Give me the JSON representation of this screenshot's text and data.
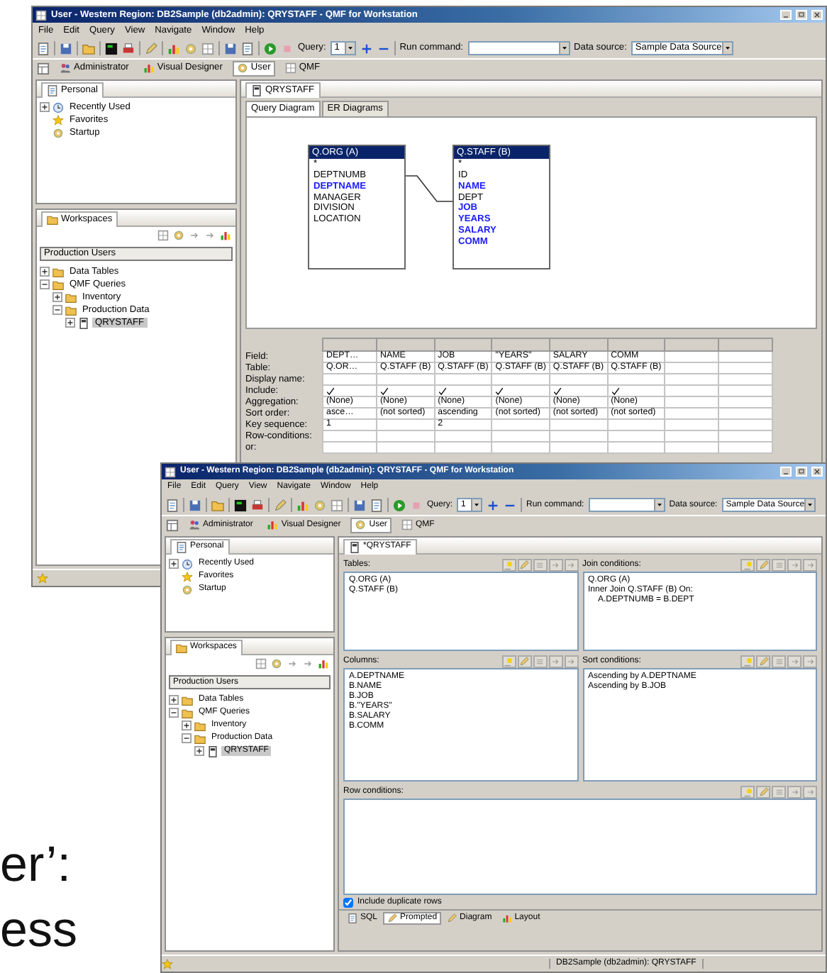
{
  "slide_text": [
    "er’:",
    "ess"
  ],
  "back_window": {
    "title": "User - Western Region: DB2Sample (db2admin): QRYSTAFF - QMF for Workstation",
    "menu": [
      "File",
      "Edit",
      "Query",
      "View",
      "Navigate",
      "Window",
      "Help"
    ],
    "toolbar": {
      "query_label": "Query:",
      "query_value": "1",
      "run_label": "Run command:",
      "source_label": "Data source:",
      "source_value": "Sample Data Source"
    },
    "perspectives": [
      {
        "label": "Administrator",
        "selected": false
      },
      {
        "label": "Visual Designer",
        "selected": false
      },
      {
        "label": "User",
        "selected": true
      },
      {
        "label": "QMF",
        "selected": false
      }
    ],
    "personal": {
      "tab": "Personal",
      "items": [
        {
          "label": "Recently Used",
          "kind": "recent",
          "expanded": false
        },
        {
          "label": "Favorites",
          "kind": "favorites"
        },
        {
          "label": "Startup",
          "kind": "startup"
        }
      ]
    },
    "workspaces": {
      "tab": "Workspaces",
      "filter": "Production Users",
      "tree": [
        {
          "label": "Data Tables",
          "kind": "folder",
          "expanded": false,
          "selected": false
        },
        {
          "label": "QMF Queries",
          "kind": "folder",
          "expanded": true,
          "selected": false,
          "children": [
            {
              "label": "Inventory",
              "kind": "folder",
              "expanded": false,
              "selected": false
            },
            {
              "label": "Production Data",
              "kind": "folder",
              "expanded": true,
              "selected": false,
              "children": [
                {
                  "label": "QRYSTAFF",
                  "kind": "query",
                  "expanded": false,
                  "selected": true
                }
              ]
            }
          ]
        }
      ]
    },
    "editor": {
      "tab": "QRYSTAFF",
      "subtabs": [
        {
          "label": "Query Diagram",
          "selected": true
        },
        {
          "label": "ER Diagrams",
          "selected": false
        }
      ],
      "tables": [
        {
          "title": "Q.ORG (A)",
          "fields": [
            {
              "name": "*",
              "selected": false
            },
            {
              "name": "DEPTNUMB",
              "selected": false
            },
            {
              "name": "DEPTNAME",
              "selected": true
            },
            {
              "name": "MANAGER",
              "selected": false
            },
            {
              "name": "DIVISION",
              "selected": false
            },
            {
              "name": "LOCATION",
              "selected": false
            }
          ]
        },
        {
          "title": "Q.STAFF (B)",
          "fields": [
            {
              "name": "*",
              "selected": false
            },
            {
              "name": "ID",
              "selected": false
            },
            {
              "name": "NAME",
              "selected": true
            },
            {
              "name": "DEPT",
              "selected": false
            },
            {
              "name": "JOB",
              "selected": true
            },
            {
              "name": "YEARS",
              "selected": true
            },
            {
              "name": "SALARY",
              "selected": true
            },
            {
              "name": "COMM",
              "selected": true
            }
          ]
        }
      ],
      "grid": {
        "row_labels": [
          "Field:",
          "Table:",
          "Display name:",
          "Include:",
          "Aggregation:",
          "Sort order:",
          "Key sequence:",
          "Row-conditions:",
          "or:"
        ],
        "columns": [
          {
            "field": "DEPT…",
            "table": "Q.OR…",
            "include": true,
            "aggregation": "(None)",
            "sort_order": "asce…",
            "key_sequence": "1"
          },
          {
            "field": "NAME",
            "table": "Q.STAFF (B)",
            "include": true,
            "aggregation": "(None)",
            "sort_order": "(not sorted)"
          },
          {
            "field": "JOB",
            "table": "Q.STAFF (B)",
            "include": true,
            "aggregation": "(None)",
            "sort_order": "ascending",
            "key_sequence": "2"
          },
          {
            "field": "\"YEARS\"",
            "table": "Q.STAFF (B)",
            "include": true,
            "aggregation": "(None)",
            "sort_order": "(not sorted)"
          },
          {
            "field": "SALARY",
            "table": "Q.STAFF (B)",
            "include": true,
            "aggregation": "(None)",
            "sort_order": "(not sorted)"
          },
          {
            "field": "COMM",
            "table": "Q.STAFF (B)",
            "include": true,
            "aggregation": "(None)",
            "sort_order": "(not sorted)"
          }
        ]
      }
    }
  },
  "front_window": {
    "title": "User - Western Region: DB2Sample (db2admin): QRYSTAFF - QMF for Workstation",
    "menu": [
      "File",
      "Edit",
      "Query",
      "View",
      "Navigate",
      "Window",
      "Help"
    ],
    "toolbar": {
      "query_label": "Query:",
      "query_value": "1",
      "run_label": "Run command:",
      "source_label": "Data source:",
      "source_value": "Sample Data Source"
    },
    "perspectives": [
      {
        "label": "Administrator",
        "selected": false
      },
      {
        "label": "Visual Designer",
        "selected": false
      },
      {
        "label": "User",
        "selected": true
      },
      {
        "label": "QMF",
        "selected": false
      }
    ],
    "personal": {
      "tab": "Personal",
      "items": [
        {
          "label": "Recently Used",
          "kind": "recent",
          "expanded": false
        },
        {
          "label": "Favorites",
          "kind": "favorites"
        },
        {
          "label": "Startup",
          "kind": "startup"
        }
      ]
    },
    "workspaces": {
      "tab": "Workspaces",
      "filter": "Production Users",
      "tree": [
        {
          "label": "Data Tables",
          "kind": "folder",
          "expanded": false,
          "selected": false
        },
        {
          "label": "QMF Queries",
          "kind": "folder",
          "expanded": true,
          "selected": false,
          "children": [
            {
              "label": "Inventory",
              "kind": "folder",
              "expanded": false,
              "selected": false
            },
            {
              "label": "Production Data",
              "kind": "folder",
              "expanded": true,
              "selected": false,
              "children": [
                {
                  "label": "QRYSTAFF",
                  "kind": "query",
                  "expanded": false,
                  "selected": true
                }
              ]
            }
          ]
        }
      ]
    },
    "editor": {
      "tab": "*QRYSTAFF",
      "panels": [
        {
          "label": "Tables:",
          "lines": [
            {
              "text": "Q.ORG (A)"
            },
            {
              "text": "Q.STAFF (B)"
            }
          ]
        },
        {
          "label": "Join conditions:",
          "lines": [
            {
              "text": "Q.ORG (A)"
            },
            {
              "text": "Inner Join Q.STAFF (B) On:",
              "children": [
                {
                  "text": "A.DEPTNUMB = B.DEPT"
                }
              ]
            }
          ]
        },
        {
          "label": "Columns:",
          "lines": [
            {
              "text": "A.DEPTNAME"
            },
            {
              "text": "B.NAME"
            },
            {
              "text": "B.JOB"
            },
            {
              "text": "B.\"YEARS\""
            },
            {
              "text": "B.SALARY"
            },
            {
              "text": "B.COMM"
            }
          ]
        },
        {
          "label": "Sort conditions:",
          "lines": [
            {
              "text": "Ascending by A.DEPTNAME"
            },
            {
              "text": "Ascending by B.JOB"
            }
          ]
        },
        {
          "label": "Row conditions:"
        }
      ],
      "include_duplicates": {
        "label": "Include duplicate rows",
        "checked": true
      },
      "view_tabs": [
        {
          "label": "SQL",
          "selected": false
        },
        {
          "label": "Prompted",
          "selected": true
        },
        {
          "label": "Diagram",
          "selected": false
        },
        {
          "label": "Layout",
          "selected": false
        }
      ]
    },
    "status": "DB2Sample (db2admin): QRYSTAFF"
  }
}
